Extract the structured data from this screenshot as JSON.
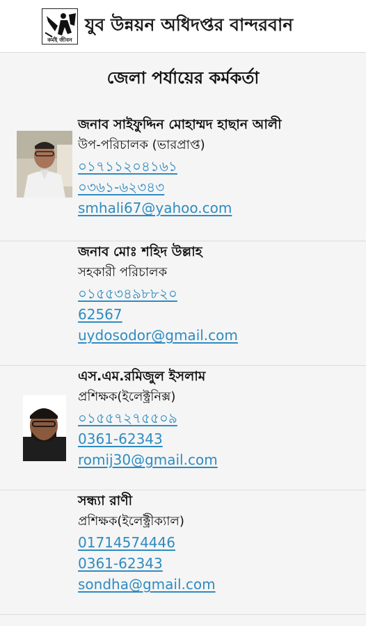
{
  "app": {
    "title": "যুব উন্নয়ন অধিদপ্তর বান্দরবান",
    "logo_caption": "কর্মই জীবন"
  },
  "section": {
    "heading": "জেলা পর্যায়ের কর্মকর্তা"
  },
  "people": [
    {
      "name": "জনাব সাইফুদ্দিন মোহাম্মদ হাছান আলী",
      "title": "উপ-পরিচালক (ভারপ্রাপ্ত)",
      "mobile": "০১৭১১২০৪১৬১",
      "phone": "০৩৬১-৬২৩৪৩",
      "email": "smhali67@yahoo.com"
    },
    {
      "name": "জনাব মোঃ শহিদ উল্লাহ",
      "title": "সহকারী পরিচালক",
      "mobile": "০১৫৫৩৪৯৮৮২০",
      "phone": "62567",
      "email": "uydosodor@gmail.com"
    },
    {
      "name": "এস.এম.রমিজুল ইসলাম",
      "title": "প্রশিক্ষক(ইলেক্ট্রনিক্স)",
      "mobile": "০১৫৫৭২৭৫৫০৯",
      "phone": "0361-62343",
      "email": "romij30@gmail.com"
    },
    {
      "name": "সন্ধ্যা রাণী",
      "title": "প্রশিক্ষক(ইলেক্ট্রীক্যাল)",
      "mobile": "01714574446",
      "phone": "0361-62343",
      "email": "sondha@gmail.com"
    }
  ]
}
